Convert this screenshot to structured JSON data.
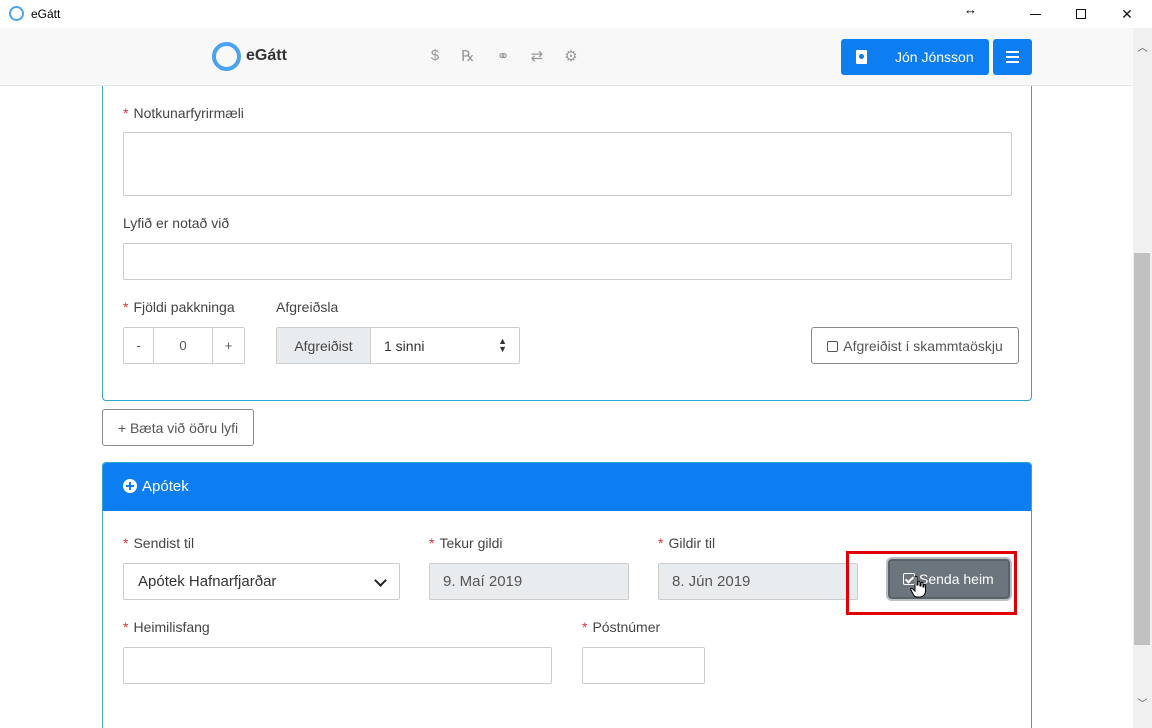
{
  "window": {
    "title": "eGátt",
    "resize_glyph": "↔",
    "close_glyph": "✕"
  },
  "navbar": {
    "brand": "eGátt",
    "icons": [
      "dollar-icon",
      "prescription-icon",
      "pills-icon",
      "exchange-icon",
      "settings-icon"
    ],
    "icon_glyphs": [
      "$",
      "℞",
      "⚭",
      "⇄",
      "⚙"
    ],
    "user_name": "Jón Jónsson",
    "accent_color": "#0d7ef2"
  },
  "medication": {
    "usage_label": "Notkunarfyrirmæli",
    "usage_value": "",
    "used_for_label": "Lyfið er notað við",
    "used_for_value": "",
    "package_count_label": "Fjöldi pakkninga",
    "stepper_minus": "-",
    "package_count": "0",
    "stepper_plus": "+",
    "dispensing_label": "Afgreiðsla",
    "dispensing_addon": "Afgreiðist",
    "dispensing_value": "1 sinni",
    "dose_box_label": "Afgreiðist í skammtaöskju",
    "add_drug_label": "+ Bæta við öðru lyfi"
  },
  "pharmacy": {
    "title": "Apótek",
    "send_to_label": "Sendist til",
    "send_to_value": "Apótek Hafnarfjarðar",
    "valid_from_label": "Tekur gildi",
    "valid_from_value": "9. Maí 2019",
    "valid_until_label": "Gildir til",
    "valid_until_value": "8. Jún 2019",
    "send_home_label": "Senda heim",
    "address_label": "Heimilisfang",
    "address_value": "",
    "postcode_label": "Póstnúmer",
    "postcode_value": ""
  },
  "required_marker": "*",
  "colors": {
    "primary": "#0d7ef2",
    "card_border": "#2fa8c9",
    "required": "#e03131",
    "highlight": "#e00000",
    "secondary_button": "#6c757d"
  }
}
